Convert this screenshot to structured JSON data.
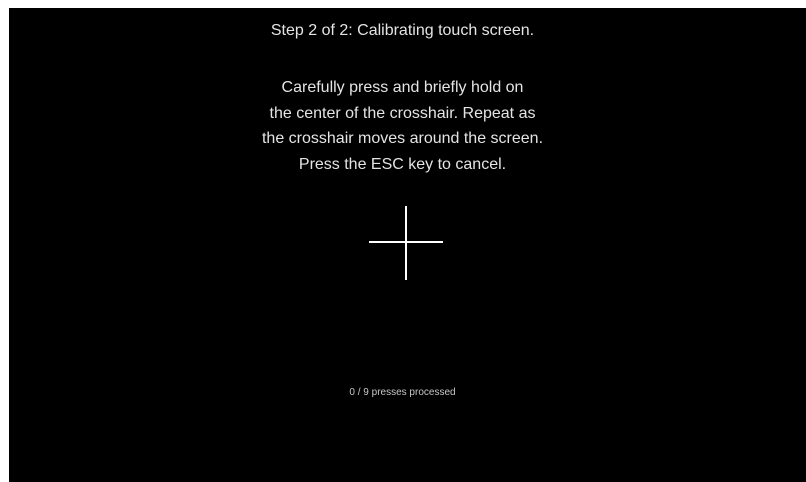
{
  "calibration": {
    "step_title": "Step 2 of 2: Calibrating touch screen.",
    "instructions": [
      "Carefully press and briefly hold on",
      "the center of the crosshair. Repeat as",
      "the crosshair moves around the screen.",
      "Press the ESC key to cancel."
    ],
    "progress_text": "0 / 9 presses processed",
    "presses_processed": 0,
    "presses_total": 9
  },
  "colors": {
    "background": "#000000",
    "text": "#e4e4e4",
    "crosshair": "#ffffff"
  }
}
